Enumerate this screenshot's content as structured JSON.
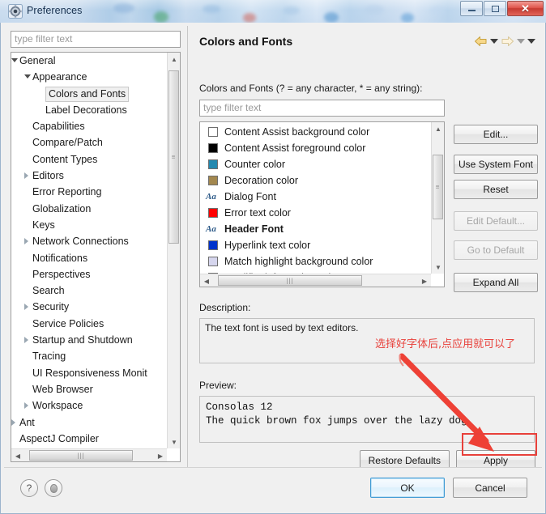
{
  "window": {
    "title": "Preferences",
    "icon": "preferences-gear-icon",
    "controls": {
      "minimize": "minimize-button",
      "maximize": "maximize-button",
      "close": "✕"
    }
  },
  "sidebar": {
    "filter_placeholder": "type filter text",
    "tree": [
      {
        "label": "General",
        "indent": 0,
        "toggle": "open",
        "selected": false
      },
      {
        "label": "Appearance",
        "indent": 1,
        "toggle": "open",
        "selected": false
      },
      {
        "label": "Colors and Fonts",
        "indent": 2,
        "toggle": "none",
        "selected": true
      },
      {
        "label": "Label Decorations",
        "indent": 2,
        "toggle": "none",
        "selected": false
      },
      {
        "label": "Capabilities",
        "indent": 1,
        "toggle": "none",
        "selected": false
      },
      {
        "label": "Compare/Patch",
        "indent": 1,
        "toggle": "none",
        "selected": false
      },
      {
        "label": "Content Types",
        "indent": 1,
        "toggle": "none",
        "selected": false
      },
      {
        "label": "Editors",
        "indent": 1,
        "toggle": "closed",
        "selected": false
      },
      {
        "label": "Error Reporting",
        "indent": 1,
        "toggle": "none",
        "selected": false
      },
      {
        "label": "Globalization",
        "indent": 1,
        "toggle": "none",
        "selected": false
      },
      {
        "label": "Keys",
        "indent": 1,
        "toggle": "none",
        "selected": false
      },
      {
        "label": "Network Connections",
        "indent": 1,
        "toggle": "closed",
        "selected": false
      },
      {
        "label": "Notifications",
        "indent": 1,
        "toggle": "none",
        "selected": false
      },
      {
        "label": "Perspectives",
        "indent": 1,
        "toggle": "none",
        "selected": false
      },
      {
        "label": "Search",
        "indent": 1,
        "toggle": "none",
        "selected": false
      },
      {
        "label": "Security",
        "indent": 1,
        "toggle": "closed",
        "selected": false
      },
      {
        "label": "Service Policies",
        "indent": 1,
        "toggle": "none",
        "selected": false
      },
      {
        "label": "Startup and Shutdown",
        "indent": 1,
        "toggle": "closed",
        "selected": false
      },
      {
        "label": "Tracing",
        "indent": 1,
        "toggle": "none",
        "selected": false
      },
      {
        "label": "UI Responsiveness Monit",
        "indent": 1,
        "toggle": "none",
        "selected": false
      },
      {
        "label": "Web Browser",
        "indent": 1,
        "toggle": "none",
        "selected": false
      },
      {
        "label": "Workspace",
        "indent": 1,
        "toggle": "closed",
        "selected": false
      },
      {
        "label": "Ant",
        "indent": 0,
        "toggle": "closed",
        "selected": false
      },
      {
        "label": "AspectJ Compiler",
        "indent": 0,
        "toggle": "none",
        "selected": false
      }
    ]
  },
  "page": {
    "title": "Colors and Fonts",
    "nav": {
      "back": "back-arrow",
      "back_menu": "back-dropdown",
      "forward": "forward-arrow",
      "forward_menu": "forward-dropdown",
      "view_menu": "view-menu"
    },
    "list_label": "Colors and Fonts (? = any character, * = any string):",
    "list_filter_placeholder": "type filter text",
    "list_items": [
      {
        "label": "Content Assist background color",
        "kind": "color",
        "color": "#ffffff",
        "bold": false
      },
      {
        "label": "Content Assist foreground color",
        "kind": "color",
        "color": "#000000",
        "bold": false
      },
      {
        "label": "Counter color",
        "kind": "color",
        "color": "#2389b0",
        "bold": false
      },
      {
        "label": "Decoration color",
        "kind": "color",
        "color": "#a3884f",
        "bold": false
      },
      {
        "label": "Dialog Font",
        "kind": "font",
        "glyph": "Aa",
        "bold": false
      },
      {
        "label": "Error text color",
        "kind": "color",
        "color": "#ff0000",
        "bold": false
      },
      {
        "label": "Header Font",
        "kind": "font",
        "glyph": "Aa",
        "bold": true
      },
      {
        "label": "Hyperlink text color",
        "kind": "color",
        "color": "#0033cc",
        "bold": false
      },
      {
        "label": "Match highlight background color",
        "kind": "color",
        "color": "#d6d6ee",
        "bold": false
      },
      {
        "label": "Qualifier information color",
        "kind": "color",
        "color": "#6e6e6e",
        "bold": false
      }
    ],
    "buttons": [
      {
        "label": "Edit...",
        "enabled": true
      },
      {
        "label": "Use System Font",
        "enabled": true
      },
      {
        "label": "Reset",
        "enabled": true
      },
      {
        "label": "Edit Default...",
        "enabled": false
      },
      {
        "label": "Go to Default",
        "enabled": false
      },
      {
        "label": "Expand All",
        "enabled": true
      }
    ],
    "description_label": "Description:",
    "description_text": "The text font is used by text editors.",
    "preview_label": "Preview:",
    "preview_line1": "Consolas 12",
    "preview_line2": "The quick brown fox jumps over the lazy dog.",
    "restore_defaults_label": "Restore Defaults",
    "apply_label": "Apply"
  },
  "footer": {
    "help_icon": "?",
    "pin_icon": "pin-icon",
    "ok_label": "OK",
    "cancel_label": "Cancel"
  },
  "annotation": {
    "text": "选择好字体后,点应用就可以了",
    "color": "#e8403a",
    "arrow": "red-arrow-pointing-to-apply",
    "highlight": "red-box-around-apply-button"
  }
}
